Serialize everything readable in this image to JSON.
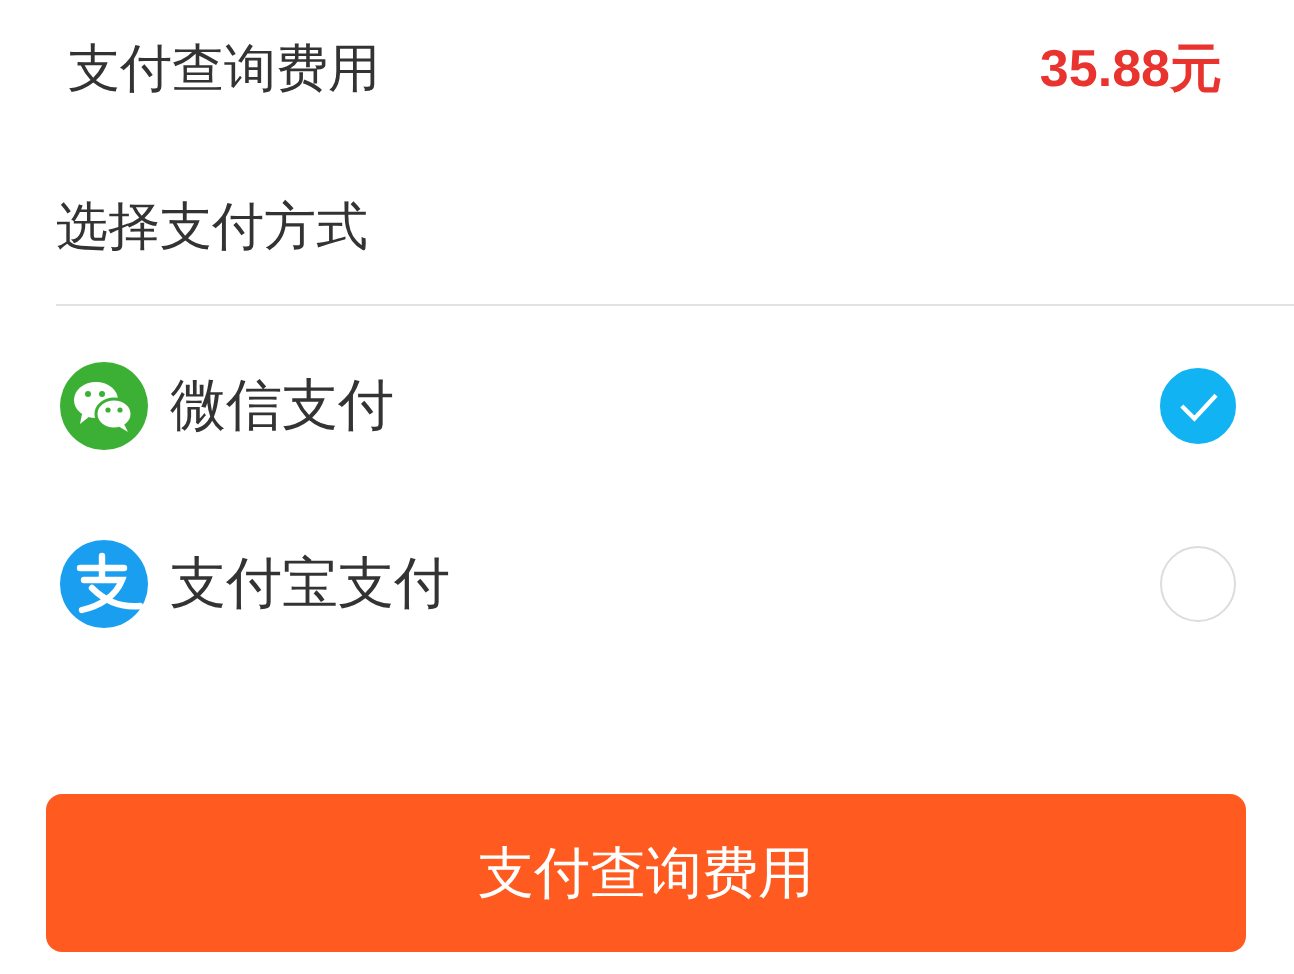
{
  "summary": {
    "label": "支付查询费用",
    "amount": "35.88元"
  },
  "section_title": "选择支付方式",
  "payment_methods": [
    {
      "kind": "wechat",
      "label": "微信支付",
      "selected": true
    },
    {
      "kind": "alipay",
      "label": "支付宝支付",
      "selected": false
    }
  ],
  "submit_button": "支付查询费用"
}
